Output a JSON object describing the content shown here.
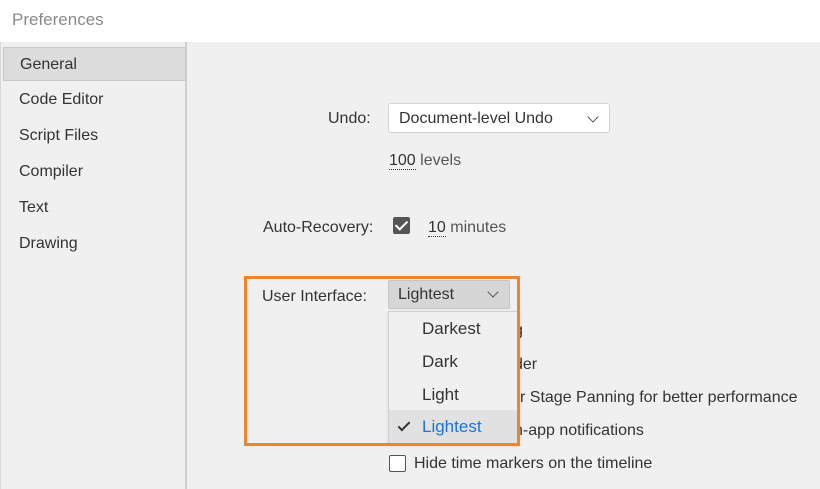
{
  "window": {
    "title": "Preferences"
  },
  "sidebar": {
    "items": [
      {
        "label": "General",
        "active": true
      },
      {
        "label": "Code Editor"
      },
      {
        "label": "Script Files"
      },
      {
        "label": "Compiler"
      },
      {
        "label": "Text"
      },
      {
        "label": "Drawing"
      }
    ]
  },
  "general": {
    "undo": {
      "label": "Undo:",
      "value": "Document-level Undo",
      "levels_value": "100",
      "levels_suffix": "levels"
    },
    "auto_recovery": {
      "label": "Auto-Recovery:",
      "checked": true,
      "value": "10",
      "suffix": "minutes"
    },
    "user_interface": {
      "label": "User Interface:",
      "value": "Lightest",
      "options": [
        "Darkest",
        "Dark",
        "Light",
        "Lightest"
      ],
      "selected_index": 3
    },
    "partial_options": [
      {
        "visible_text": "g"
      },
      {
        "visible_text": "der"
      },
      {
        "visible_text": "r Stage Panning for better performance"
      },
      {
        "visible_text": "n-app notifications"
      }
    ],
    "hide_time_markers": {
      "label": "Hide time markers on the timeline",
      "checked": false
    }
  },
  "colors": {
    "highlight": "#f0842a",
    "selected_text": "#1a73d9"
  }
}
